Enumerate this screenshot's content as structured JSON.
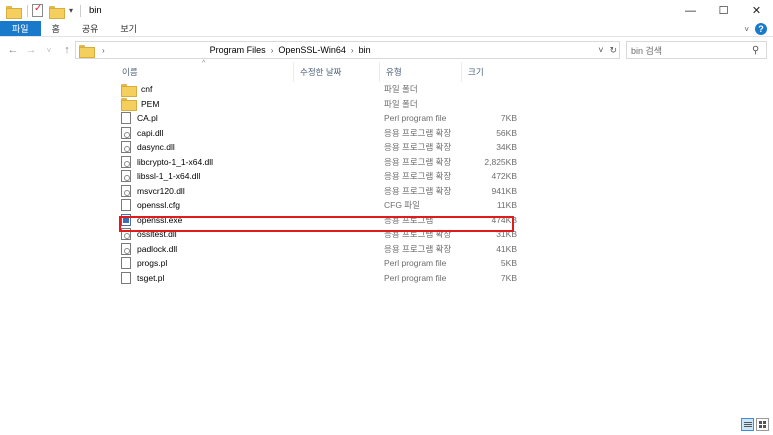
{
  "window": {
    "title": "bin",
    "controls": {
      "minimize": "—",
      "maximize": "☐",
      "close": "✕"
    }
  },
  "ribbon": {
    "tabs": [
      "파일",
      "홈",
      "공유",
      "보기"
    ],
    "expand": "˅",
    "help": "?"
  },
  "address": {
    "root_arrow": "›",
    "crumbs": [
      "Program Files",
      "OpenSSL-Win64",
      "bin"
    ]
  },
  "search": {
    "placeholder": "bin 검색"
  },
  "columns": {
    "name": "이름",
    "date": "수정한 날짜",
    "type": "유형",
    "size": "크기"
  },
  "files": [
    {
      "name": "cnf",
      "type": "파일 폴더",
      "size": "",
      "icon": "folder"
    },
    {
      "name": "PEM",
      "type": "파일 폴더",
      "size": "",
      "icon": "folder"
    },
    {
      "name": "CA.pl",
      "type": "Perl program file",
      "size": "7KB",
      "icon": "file"
    },
    {
      "name": "capi.dll",
      "type": "응용 프로그램 확장",
      "size": "56KB",
      "icon": "dll"
    },
    {
      "name": "dasync.dll",
      "type": "응용 프로그램 확장",
      "size": "34KB",
      "icon": "dll"
    },
    {
      "name": "libcrypto-1_1-x64.dll",
      "type": "응용 프로그램 확장",
      "size": "2,825KB",
      "icon": "dll"
    },
    {
      "name": "libssl-1_1-x64.dll",
      "type": "응용 프로그램 확장",
      "size": "472KB",
      "icon": "dll"
    },
    {
      "name": "msvcr120.dll",
      "type": "응용 프로그램 확장",
      "size": "941KB",
      "icon": "dll"
    },
    {
      "name": "openssl.cfg",
      "type": "CFG 파일",
      "size": "11KB",
      "icon": "file"
    },
    {
      "name": "openssl.exe",
      "type": "응용 프로그램",
      "size": "474KB",
      "icon": "exe"
    },
    {
      "name": "ossltest.dll",
      "type": "응용 프로그램 확장",
      "size": "31KB",
      "icon": "dll"
    },
    {
      "name": "padlock.dll",
      "type": "응용 프로그램 확장",
      "size": "41KB",
      "icon": "dll"
    },
    {
      "name": "progs.pl",
      "type": "Perl program file",
      "size": "5KB",
      "icon": "file"
    },
    {
      "name": "tsget.pl",
      "type": "Perl program file",
      "size": "7KB",
      "icon": "file"
    }
  ],
  "highlighted_file": "libcrypto-1_1-x64.dll",
  "colors": {
    "accent": "#1979ca",
    "highlight": "#e01b1b",
    "folder": "#f5cf5e"
  }
}
